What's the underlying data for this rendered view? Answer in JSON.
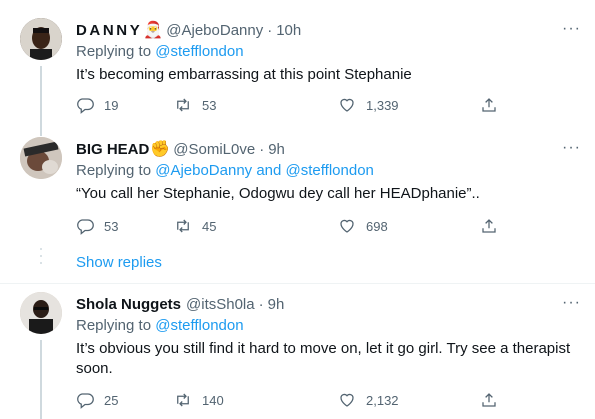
{
  "tweets": [
    {
      "name": "DANNY",
      "emoji": "🎅",
      "handle": "@AjeboDanny",
      "time": "10h",
      "replying_prefix": "Replying to ",
      "replying_to": "@stefflondon",
      "text": "It’s becoming embarrassing at this point Stephanie",
      "replies": "19",
      "retweets": "53",
      "likes": "1,339"
    },
    {
      "name": "BIG HEAD",
      "emoji": "✊",
      "handle": "@SomiL0ve",
      "time": "9h",
      "replying_prefix": "Replying to ",
      "replying_to": "@AjeboDanny and @stefflondon",
      "text": "“You call her Stephanie, Odogwu dey call her HEADphanie”..",
      "replies": "53",
      "retweets": "45",
      "likes": "698"
    },
    {
      "name": "Shola Nuggets",
      "emoji": "",
      "handle": "@itsSh0la",
      "time": "9h",
      "replying_prefix": "Replying to ",
      "replying_to": "@stefflondon",
      "text": "It’s obvious you still find it hard to move on, let it go girl. Try see a therapist soon.",
      "replies": "25",
      "retweets": "140",
      "likes": "2,132"
    }
  ],
  "show_replies": "Show replies",
  "separator": "·",
  "more_glyph": "···",
  "icons": {
    "reply": "reply-icon",
    "retweet": "retweet-icon",
    "like": "heart-icon",
    "share": "share-icon",
    "more": "more-icon"
  },
  "colors": {
    "link": "#1d9bf0",
    "secondary": "#536471",
    "primary": "#0f1419",
    "thread_line": "#cfd9de"
  }
}
